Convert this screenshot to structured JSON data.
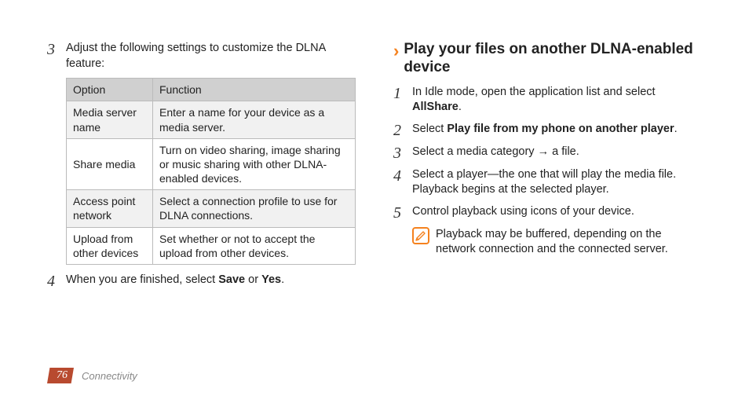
{
  "left": {
    "step3": {
      "num": "3",
      "text": "Adjust the following settings to customize the DLNA feature:"
    },
    "table": {
      "headers": [
        "Option",
        "Function"
      ],
      "rows": [
        {
          "opt": "Media server name",
          "fn": "Enter a name for your device as a media server."
        },
        {
          "opt": "Share media",
          "fn": "Turn on video sharing, image sharing or music sharing with other DLNA-enabled devices."
        },
        {
          "opt": "Access point network",
          "fn": "Select a connection profile to use for DLNA connections."
        },
        {
          "opt": "Upload from other devices",
          "fn": "Set whether or not to accept the upload from other devices."
        }
      ]
    },
    "step4": {
      "num": "4",
      "prefix": "When you are finished, select ",
      "save": "Save",
      "or": " or ",
      "yes": "Yes",
      "suffix": "."
    }
  },
  "right": {
    "heading": "Play your files on another DLNA-enabled device",
    "step1": {
      "num": "1",
      "prefix": "In Idle mode, open the application list and select ",
      "bold": "AllShare",
      "suffix": "."
    },
    "step2": {
      "num": "2",
      "prefix": "Select ",
      "bold": "Play file from my phone on another player",
      "suffix": "."
    },
    "step3": {
      "num": "3",
      "text": "Select a media category → a file."
    },
    "step4": {
      "num": "4",
      "text": "Select a player—the one that will play the media file. Playback begins at the selected player."
    },
    "step5": {
      "num": "5",
      "text": "Control playback using icons of your device."
    },
    "note": "Playback may be buffered, depending on the network connection and the connected server."
  },
  "footer": {
    "page": "76",
    "section": "Connectivity"
  }
}
